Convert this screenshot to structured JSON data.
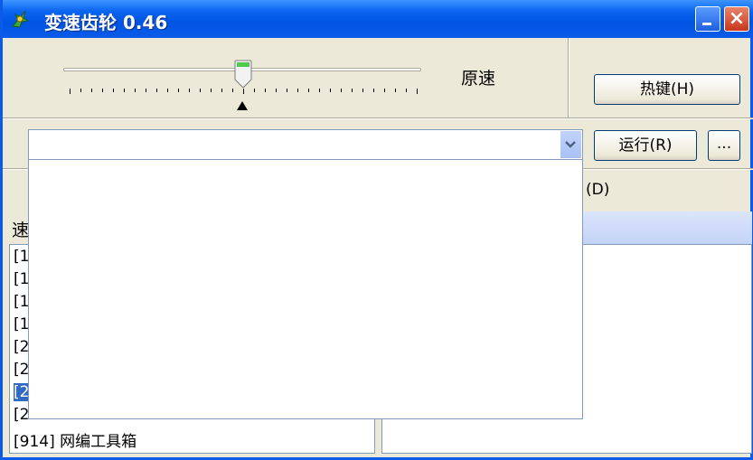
{
  "window": {
    "title": "变速齿轮 0.46"
  },
  "icons": {
    "app": "gear-app-icon",
    "minimize": "minimize-icon",
    "close": "close-icon",
    "dropdown": "chevron-down-icon",
    "slider_pointer": "triangle-up-icon"
  },
  "colors": {
    "titlebar": "#0054e3",
    "selection": "#316ac5",
    "close_button": "#c8361b"
  },
  "speed": {
    "label": "原速"
  },
  "buttons": {
    "hotkey": "热键(H)",
    "run": "运行(R)",
    "more": "..."
  },
  "labels": {
    "d_suffix": "(D)",
    "speed_prefix": "速"
  },
  "process_list": [
    {
      "text": "[1",
      "selected": false
    },
    {
      "text": "[1",
      "selected": false
    },
    {
      "text": "[1",
      "selected": false
    },
    {
      "text": "[1",
      "selected": false
    },
    {
      "text": "[2",
      "selected": false
    },
    {
      "text": "[2",
      "selected": false
    },
    {
      "text": "[2",
      "selected": true
    },
    {
      "text": "[2",
      "selected": false
    },
    {
      "text": "[914]  网编工具箱",
      "selected": false
    }
  ]
}
